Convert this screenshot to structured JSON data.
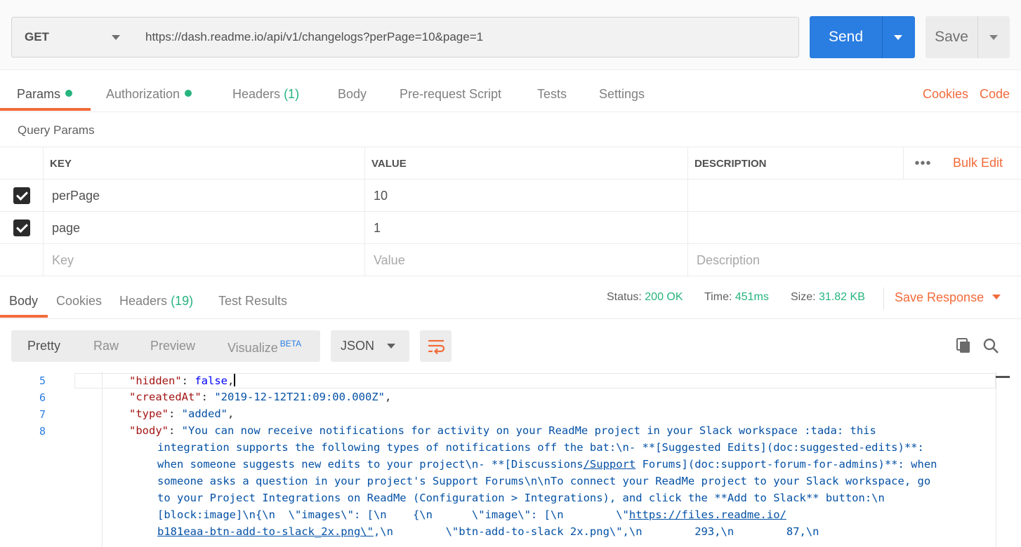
{
  "request": {
    "method": "GET",
    "url": "https://dash.readme.io/api/v1/changelogs?perPage=10&page=1",
    "send_label": "Send",
    "save_label": "Save"
  },
  "request_tabs": [
    {
      "label": "Params",
      "dot": true,
      "active": true
    },
    {
      "label": "Authorization",
      "dot": true
    },
    {
      "label": "Headers",
      "count": "(1)"
    },
    {
      "label": "Body"
    },
    {
      "label": "Pre-request Script"
    },
    {
      "label": "Tests"
    },
    {
      "label": "Settings"
    }
  ],
  "top_links": {
    "cookies": "Cookies",
    "code": "Code"
  },
  "query_params": {
    "title": "Query Params",
    "headers": {
      "key": "KEY",
      "value": "VALUE",
      "description": "DESCRIPTION"
    },
    "bulk_edit": "Bulk Edit",
    "more": "•••",
    "rows": [
      {
        "checked": true,
        "key": "perPage",
        "value": "10",
        "description": ""
      },
      {
        "checked": true,
        "key": "page",
        "value": "1",
        "description": ""
      }
    ],
    "placeholders": {
      "key": "Key",
      "value": "Value",
      "description": "Description"
    }
  },
  "response_tabs": [
    {
      "label": "Body",
      "active": true
    },
    {
      "label": "Cookies"
    },
    {
      "label": "Headers",
      "count": "(19)"
    },
    {
      "label": "Test Results"
    }
  ],
  "response_meta": {
    "status_label": "Status:",
    "status": "200 OK",
    "time_label": "Time:",
    "time": "451ms",
    "size_label": "Size:",
    "size": "31.82 KB",
    "save_response": "Save Response"
  },
  "view_modes": {
    "pretty": "Pretty",
    "raw": "Raw",
    "preview": "Preview",
    "visualize": "Visualize",
    "beta": "BETA"
  },
  "format": "JSON",
  "code": {
    "line_numbers": [
      "5",
      "6",
      "7",
      "8"
    ],
    "l5_key": "\"hidden\"",
    "l5_val": "false",
    "l6_key": "\"createdAt\"",
    "l6_val": "\"2019-12-12T21:09:00.000Z\"",
    "l7_key": "\"type\"",
    "l7_val": "\"added\"",
    "l8_key": "\"body\"",
    "l8_w0": "\"You can now receive notifications for activity on your ReadMe project in your Slack workspace :tada: this",
    "l8_w1": "integration supports the following types of notifications off the bat:\\n- **[Suggested Edits](doc:suggested-edits)**:",
    "l8_w2a": "when someone suggests new edits to your project\\n- **[Discussions",
    "l8_w2b": "/Support",
    "l8_w2c": " Forums](doc:support-forum-for-admins)**: when",
    "l8_w3": "someone asks a question in your project's Support Forums\\n\\nTo connect your ReadMe project to your Slack workspace, go",
    "l8_w4": "to your Project Integrations on ReadMe (Configuration > Integrations), and click the **Add to Slack** button:\\n",
    "l8_w5a": "[block:image]\\n{\\n  \\\"images\\\": [\\n    {\\n      \\\"image\\\": [\\n        \\\"",
    "l8_w5b": "https://files.readme.io/",
    "l8_w6a": "b181eaa-btn-add-to-slack_2x.png\\\"",
    "l8_w6b": ",\\n        \\\"btn-add-to-slack 2x.png\\\",\\n        293,\\n        87,\\n"
  }
}
